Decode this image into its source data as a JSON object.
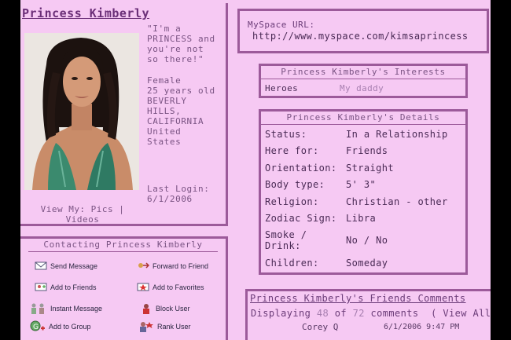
{
  "profile": {
    "name": "Princess Kimberly",
    "quote": [
      "\"I'm a",
      "PRINCESS and",
      "you're not",
      "so there!\""
    ],
    "details_lines": [
      "Female",
      "25 years old",
      "BEVERLY",
      "HILLS,",
      "CALIFORNIA",
      "United",
      "States"
    ],
    "last_login_label": "Last Login:",
    "last_login_value": "6/1/2006",
    "view_my": "View My: Pics |",
    "view_my_videos": "Videos"
  },
  "contacting": {
    "title": "Contacting Princess Kimberly",
    "actions": [
      {
        "label": "Send Message",
        "icon": "envelope-icon"
      },
      {
        "label": "Forward to Friend",
        "icon": "forward-icon"
      },
      {
        "label": "Add to Friends",
        "icon": "add-friend-icon"
      },
      {
        "label": "Add to Favorites",
        "icon": "favorites-icon"
      },
      {
        "label": "Instant Message",
        "icon": "instant-message-icon"
      },
      {
        "label": "Block User",
        "icon": "block-user-icon"
      },
      {
        "label": "Add to Group",
        "icon": "group-icon"
      },
      {
        "label": "Rank User",
        "icon": "rank-user-icon"
      }
    ]
  },
  "myspace_url": {
    "label": "MySpace URL:",
    "value": "http://www.myspace.com/kimsaprincess"
  },
  "interests": {
    "title": "Princess Kimberly's Interests",
    "rows": [
      {
        "label": "Heroes",
        "value": "My daddy"
      }
    ]
  },
  "details": {
    "title": "Princess Kimberly's Details",
    "rows": [
      {
        "label": "Status:",
        "value": "In a Relationship"
      },
      {
        "label": "Here for:",
        "value": "Friends"
      },
      {
        "label": "Orientation:",
        "value": "Straight"
      },
      {
        "label": "Body type:",
        "value": "5' 3\""
      },
      {
        "label": "Religion:",
        "value": "Christian - other"
      },
      {
        "label": "Zodiac Sign:",
        "value": "Libra"
      },
      {
        "label": "Smoke / Drink:",
        "value": "No / No"
      },
      {
        "label": "Children:",
        "value": "Someday"
      }
    ]
  },
  "friends_comments": {
    "title": "Princess Kimberly's Friends Comments",
    "displaying": "Displaying",
    "shown": "48",
    "of": "of",
    "total": "72",
    "comments_word": "comments",
    "view_all": "( View All",
    "first_comment": {
      "author": "Corey Q",
      "date": "6/1/2006 9:47 PM"
    }
  },
  "colors": {
    "page_background": "#f6c9f3",
    "border": "#9c5a9a",
    "frame": "#000000"
  }
}
